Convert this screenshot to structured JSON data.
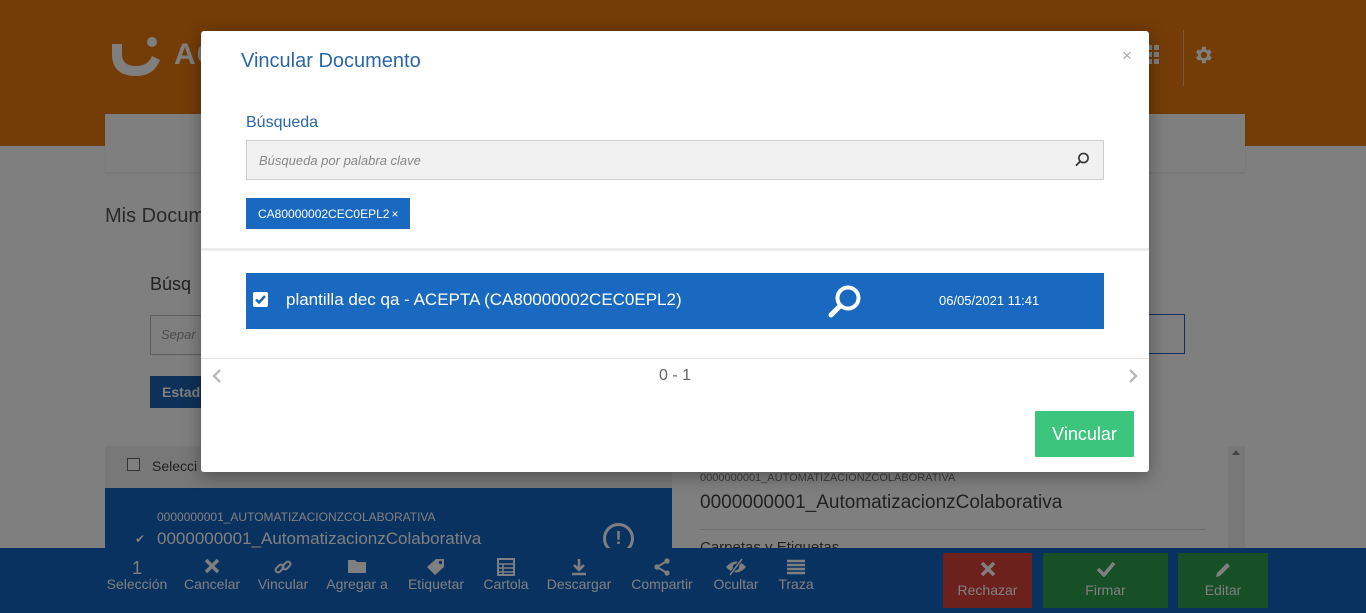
{
  "app": {
    "logo_text": "AC",
    "page_title": "Mis Docum",
    "search_label": "Búsq",
    "search_placeholder": "Separ",
    "state_button": "Estad",
    "select_all_label": "Selecci",
    "list_item": {
      "code": "0000000001_AUTOMATIZACIONZCOLABORATIVA",
      "name": "0000000001_AutomatizacionzColaborativa"
    },
    "detail": {
      "code": "0000000001_AUTOMATIZACIONZCOLABORATIVA",
      "name": "0000000001_AutomatizacionzColaborativa",
      "tags_label": "Carpetas y Etiquetas"
    }
  },
  "toolbar": {
    "selection_count": "1",
    "selection_label": "Selección",
    "cancel": "Cancelar",
    "link": "Vincular",
    "add_to": "Agregar a",
    "tag": "Etiquetar",
    "cartola": "Cartola",
    "download": "Descargar",
    "share": "Compartir",
    "hide": "Ocultar",
    "trace": "Traza",
    "reject": "Rechazar",
    "sign": "Firmar",
    "edit": "Editar"
  },
  "modal": {
    "title": "Vincular Documento",
    "close": "×",
    "search_label": "Búsqueda",
    "search_placeholder": "Búsqueda por palabra clave",
    "tag": "CA80000002CEC0EPL2",
    "tag_remove": "×",
    "result": {
      "title": "plantilla dec qa - ACEPTA (CA80000002CEC0EPL2)",
      "date": "06/05/2021 11:41",
      "checked": true
    },
    "pagination": "0 - 1",
    "submit": "Vincular"
  },
  "colors": {
    "brand_orange": "#e8780f",
    "primary_blue": "#1a69c0",
    "success_green": "#3cc57c",
    "reject_red": "#d9433a",
    "sign_green": "#2e9e4e"
  }
}
